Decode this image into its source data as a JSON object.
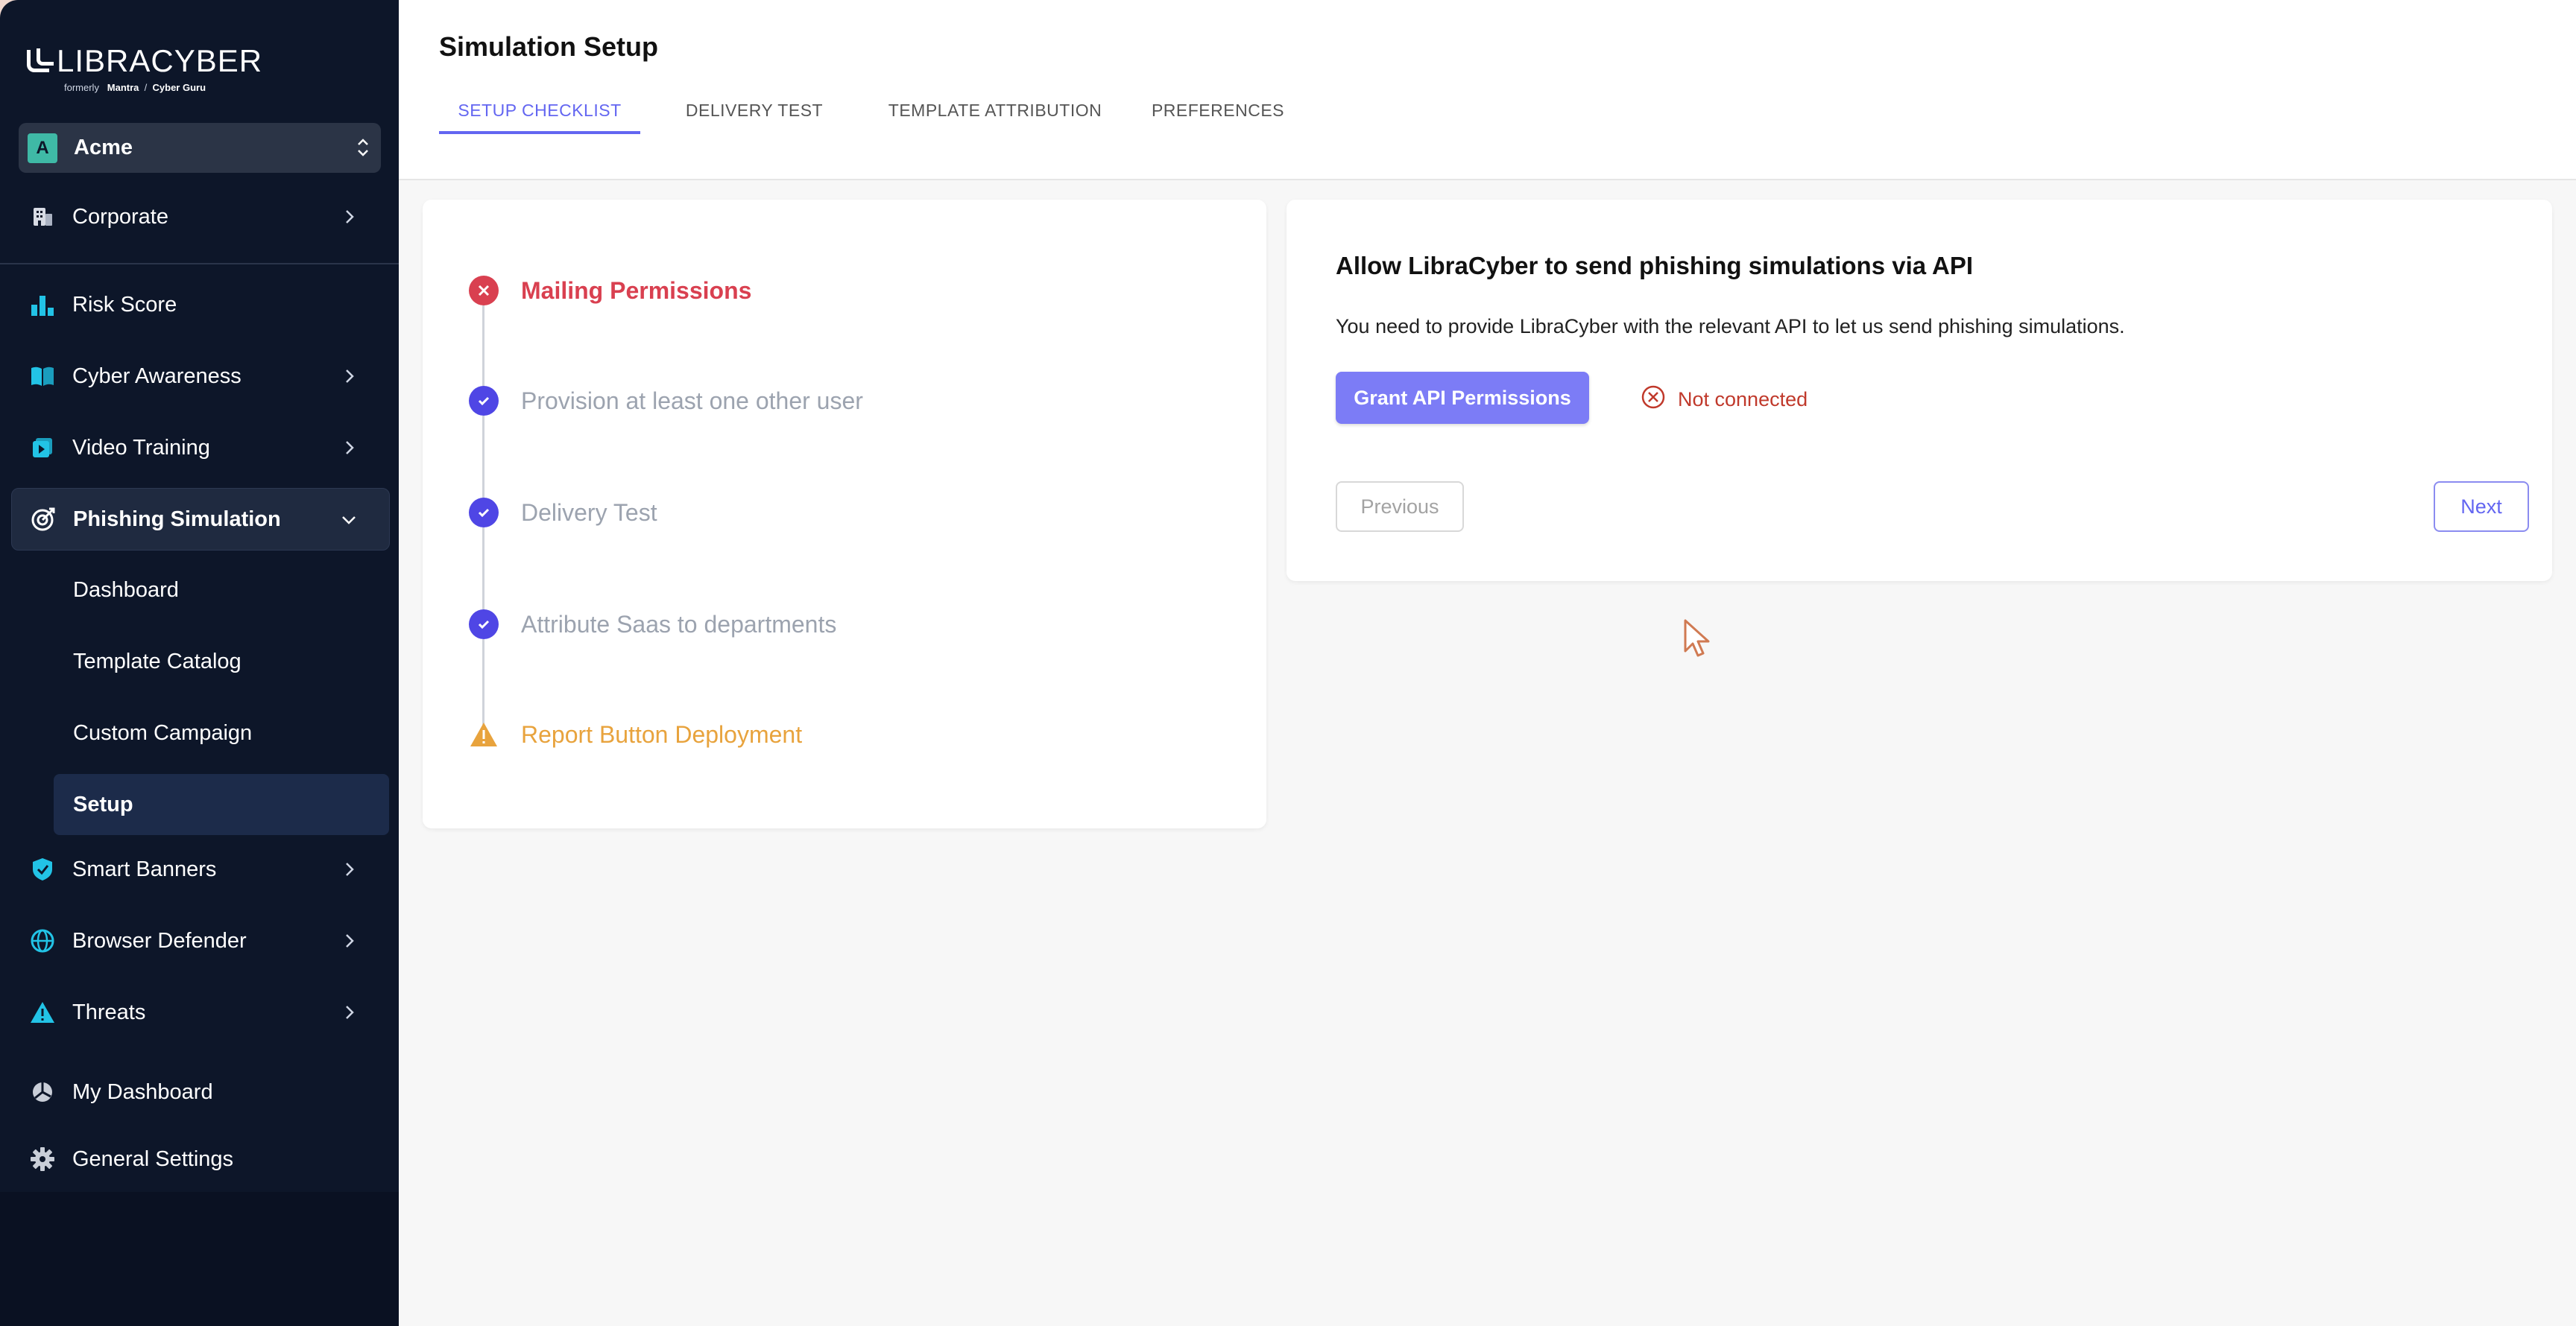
{
  "brand": {
    "name": "LIBRACYBER",
    "formerly_label": "formerly",
    "former_brand_1": "Mantra",
    "separator": "/",
    "former_brand_2": "Cyber Guru"
  },
  "org": {
    "avatar_letter": "A",
    "name": "Acme"
  },
  "sidebar": {
    "items": [
      {
        "label": "Corporate",
        "icon": "building-icon"
      },
      {
        "label": "Risk Score",
        "icon": "bar-chart-icon"
      },
      {
        "label": "Cyber Awareness",
        "icon": "book-icon"
      },
      {
        "label": "Video Training",
        "icon": "video-icon"
      },
      {
        "label": "Phishing Simulation",
        "icon": "target-icon"
      },
      {
        "label": "Smart Banners",
        "icon": "shield-icon"
      },
      {
        "label": "Browser Defender",
        "icon": "globe-icon"
      },
      {
        "label": "Threats",
        "icon": "warning-icon"
      },
      {
        "label": "My Dashboard",
        "icon": "dashboard-icon"
      },
      {
        "label": "General Settings",
        "icon": "gear-icon"
      }
    ],
    "phishing_subitems": [
      {
        "label": "Dashboard"
      },
      {
        "label": "Template Catalog"
      },
      {
        "label": "Custom Campaign"
      },
      {
        "label": "Setup"
      }
    ]
  },
  "header": {
    "title": "Simulation Setup",
    "tabs": [
      {
        "label": "SETUP CHECKLIST"
      },
      {
        "label": "DELIVERY TEST"
      },
      {
        "label": "TEMPLATE ATTRIBUTION"
      },
      {
        "label": "PREFERENCES"
      }
    ]
  },
  "steps": [
    {
      "label": "Mailing Permissions",
      "state": "error"
    },
    {
      "label": "Provision at least one other user",
      "state": "done"
    },
    {
      "label": "Delivery Test",
      "state": "done"
    },
    {
      "label": "Attribute Saas to departments",
      "state": "done"
    },
    {
      "label": "Report Button Deployment",
      "state": "warning"
    }
  ],
  "api_panel": {
    "title": "Allow LibraCyber to send phishing simulations via API",
    "description": "You need to provide LibraCyber with the relevant API to let us send phishing simulations.",
    "grant_button": "Grant API Permissions",
    "status": "Not connected",
    "previous_button": "Previous",
    "next_button": "Next"
  },
  "colors": {
    "sidebar_bg": "#0d1629",
    "accent": "#6366f1",
    "error": "#d94050",
    "warning": "#e8a33d",
    "icon_cyan": "#22c3e6",
    "step_done": "#4f46e5"
  }
}
